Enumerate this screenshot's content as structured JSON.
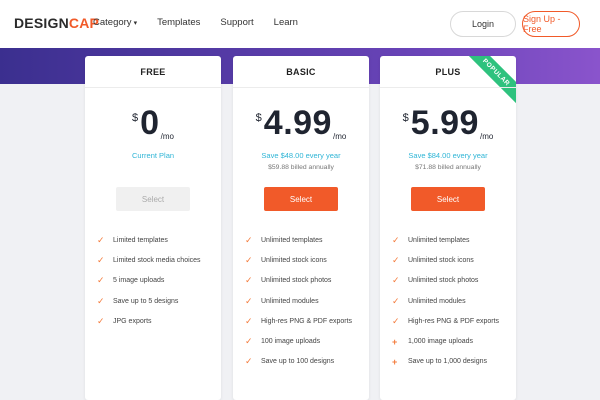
{
  "logo": {
    "part1": "DESIGN",
    "part2": "CAP"
  },
  "nav": {
    "items": [
      {
        "label": "Category"
      },
      {
        "label": "Templates"
      },
      {
        "label": "Support"
      },
      {
        "label": "Learn"
      }
    ]
  },
  "auth": {
    "login": "Login",
    "signup": "Sign Up - Free"
  },
  "plans": [
    {
      "name": "FREE",
      "currency": "$",
      "amount": "0",
      "period": "/mo",
      "sub1": "Current Plan",
      "sub2": "",
      "button": "Select",
      "features": [
        "Limited templates",
        "Limited stock media choices",
        "5 image uploads",
        "Save up to 5 designs",
        "JPG exports"
      ]
    },
    {
      "name": "BASIC",
      "currency": "$",
      "amount": "4.99",
      "period": "/mo",
      "sub1": "Save $48.00 every year",
      "sub2": "$59.88 billed annually",
      "button": "Select",
      "features": [
        "Unlimited templates",
        "Unlimited stock icons",
        "Unlimited stock photos",
        "Unlimited modules",
        "High-res PNG & PDF exports",
        "100 image uploads",
        "Save up to 100 designs"
      ]
    },
    {
      "name": "PLUS",
      "currency": "$",
      "amount": "5.99",
      "period": "/mo",
      "sub1": "Save $84.00 every year",
      "sub2": "$71.88 billed annually",
      "button": "Select",
      "ribbon": "POPULAR",
      "features": [
        "Unlimited templates",
        "Unlimited stock icons",
        "Unlimited stock photos",
        "Unlimited modules",
        "High-res PNG & PDF exports",
        "1,000 image uploads",
        "Save up to 1,000 designs"
      ]
    }
  ],
  "colors": {
    "accent": "#f15a29",
    "teal": "#2fb5d6",
    "ribbon": "#2ec27e",
    "band_start": "#3b2f8f",
    "band_end": "#8a54cc"
  },
  "icons": {
    "check": "check-icon",
    "plus": "plus-icon",
    "chevron": "chevron-down-icon"
  }
}
